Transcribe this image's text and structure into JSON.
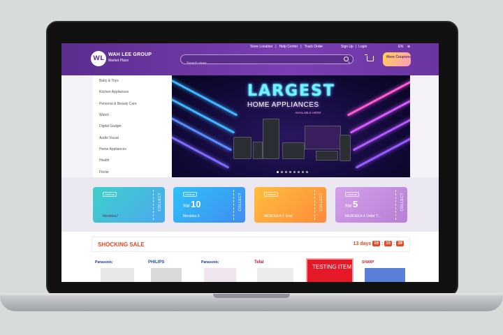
{
  "header": {
    "top_links": [
      "Store Location",
      "|",
      "Help Center",
      "|",
      "Track Order"
    ],
    "account_links": [
      "Sign Up",
      "|",
      "Login"
    ],
    "language": "EN",
    "logo_mark": "WL",
    "brand_name": "WAH LEE GROUP",
    "brand_sub": "Market Place",
    "search_placeholder": "Search store",
    "coupon_button": "More Coupons"
  },
  "sidebar": {
    "items": [
      {
        "label": "Baby & Toys"
      },
      {
        "label": "Kitchen Appliances"
      },
      {
        "label": "Personal & Beauty Care"
      },
      {
        "label": "Watch"
      },
      {
        "label": "Digital Gadget"
      },
      {
        "label": "Audio Visual"
      },
      {
        "label": "Home Appliances"
      },
      {
        "label": "Health"
      },
      {
        "label": "Florist"
      }
    ]
  },
  "banner": {
    "title": "LARGEST",
    "subtitle": "HOME APPLIANCES",
    "tagline": "AVAILABLE HERE",
    "slide_count": 8,
    "active_slide": 1
  },
  "coupons": [
    {
      "tag": "Lifetime",
      "prefix": "",
      "amount": "",
      "name": "Merdeka7",
      "action": "COLLECT",
      "color_from": "#3fd0c9",
      "color_to": "#4aa8f0"
    },
    {
      "tag": "Lifetime",
      "prefix": "RM",
      "amount": "10",
      "name": "Merdeka 6",
      "action": "COLLECT",
      "color_from": "#2fc1f7",
      "color_to": "#3f8cf2"
    },
    {
      "tag": "Lifetime",
      "prefix": "",
      "amount": "",
      "name": "MERDEKA 5 Total",
      "action": "COLLECT",
      "color_from": "#ffbe3d",
      "color_to": "#ff8a3a"
    },
    {
      "tag": "Lifetime",
      "prefix": "RM",
      "amount": "5",
      "name": "MERDEKA 4 Order T...",
      "action": "COLLECT",
      "color_from": "#d4a0e8",
      "color_to": "#b77ed6"
    }
  ],
  "sale": {
    "title": "SHOCKING SALE",
    "days": "13 days",
    "hours": "16",
    "minutes": "15",
    "seconds": "39",
    "brands": [
      "Panasonic",
      "PHILIPS",
      "Panasonic",
      "Tefal",
      "SHARP"
    ],
    "promo_tile": "TESTING ITEM"
  }
}
